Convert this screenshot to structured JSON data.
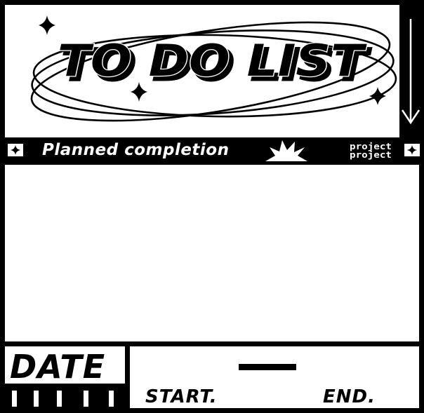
{
  "title": "TO DO LIST",
  "banner": {
    "label": "Planned completion",
    "tag": "project"
  },
  "date": {
    "label": "DATE",
    "start_label": "START.",
    "end_label": "END."
  },
  "icons": {
    "scroll_arrow": "arrow-down-icon",
    "sparkle": "sparkle-icon",
    "burst": "starburst-icon",
    "corner_star": "star-square-icon"
  },
  "colors": {
    "ink": "#000000",
    "paper": "#ffffff"
  }
}
